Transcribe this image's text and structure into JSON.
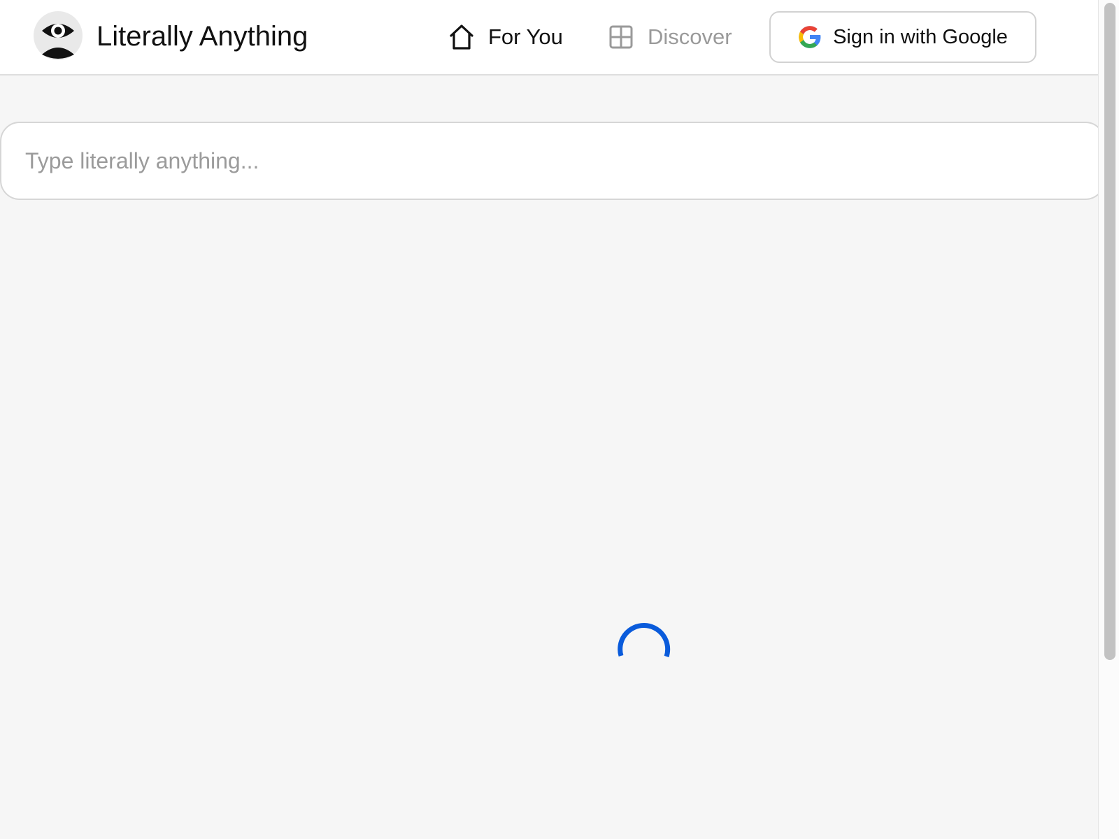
{
  "header": {
    "brand": "Literally Anything",
    "logo_icon": "eye-person-icon",
    "nav": [
      {
        "label": "For You",
        "icon": "home-icon",
        "active": true
      },
      {
        "label": "Discover",
        "icon": "grid-icon",
        "active": false
      }
    ],
    "signin": {
      "label": "Sign in with Google",
      "icon": "google-icon"
    }
  },
  "search": {
    "placeholder": "Type literally anything...",
    "value": ""
  },
  "status": {
    "loading": true,
    "spinner_color": "#0a5bdb"
  },
  "colors": {
    "background": "#f6f6f6",
    "header_bg": "#ffffff",
    "inactive_nav": "#9a9a9a",
    "accent": "#0a5bdb"
  }
}
